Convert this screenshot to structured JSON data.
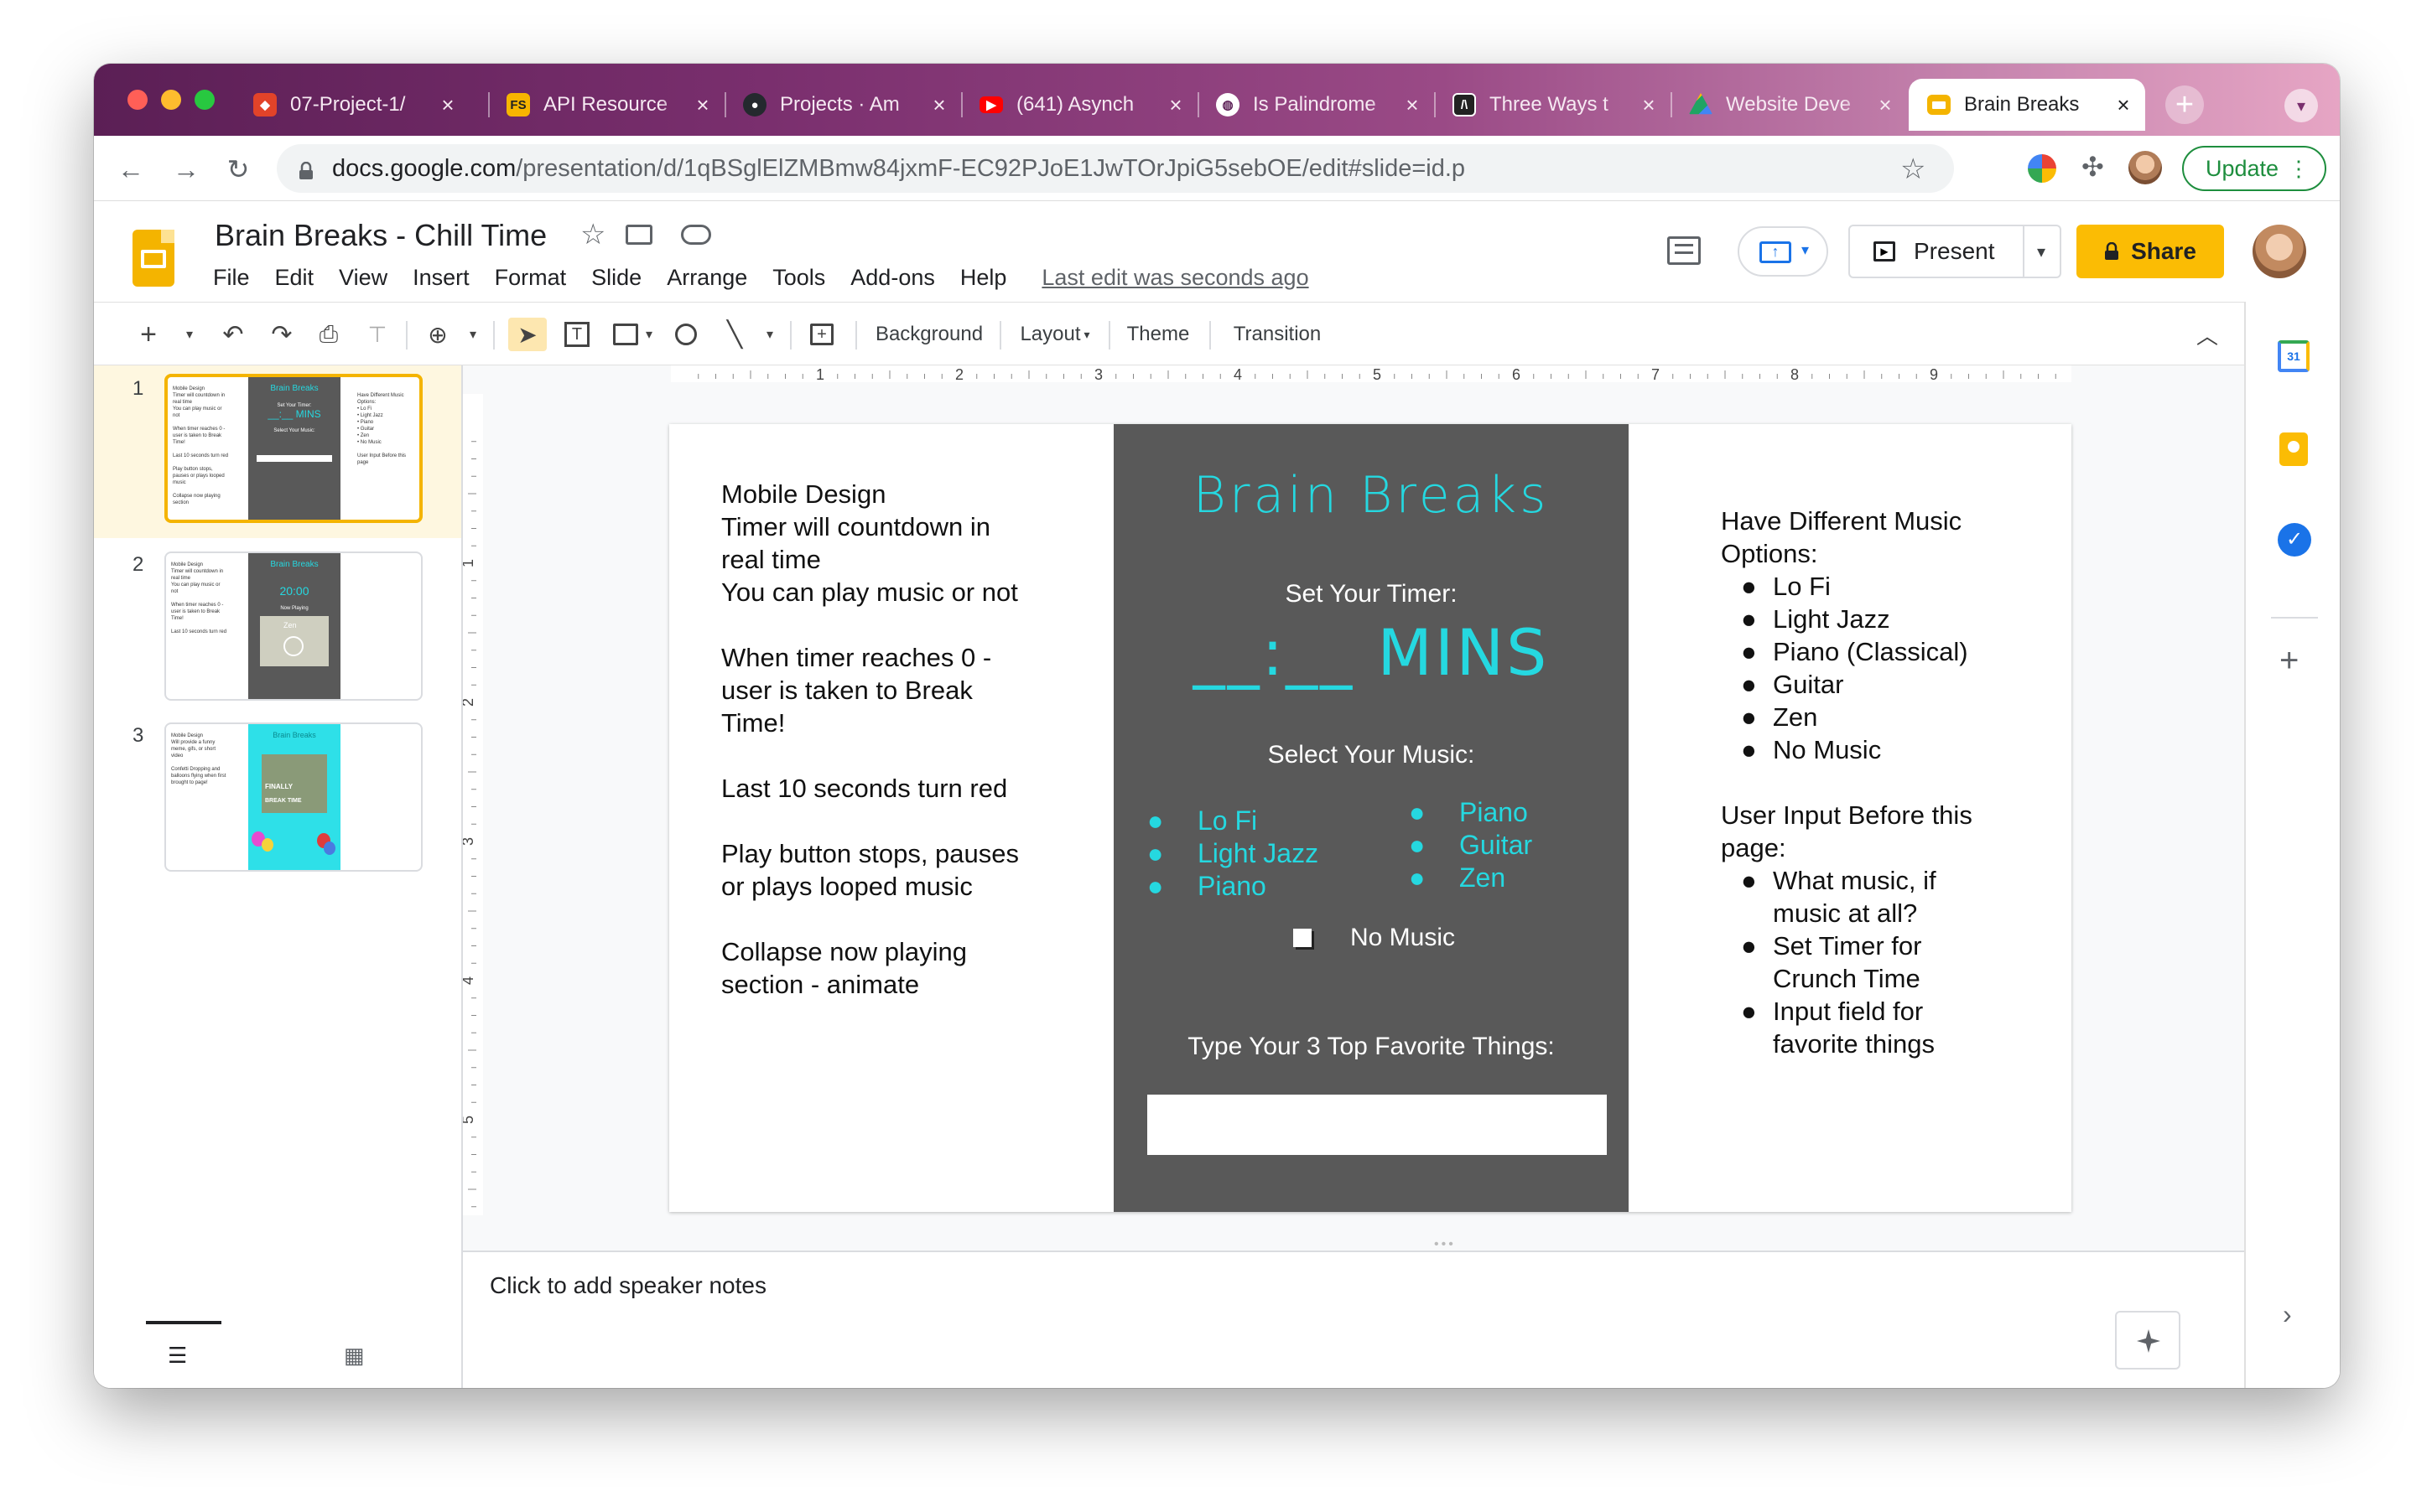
{
  "browser": {
    "tabs": [
      {
        "title": "07-Project-1/",
        "icon": "gitlab-icon",
        "color": "#e24329"
      },
      {
        "title": "API Resource",
        "icon": "fs-icon",
        "color": "#f7b500"
      },
      {
        "title": "Projects · Am",
        "icon": "github-icon",
        "color": "#24292e"
      },
      {
        "title": "(641) Asynch",
        "icon": "youtube-icon",
        "color": "#ff0000"
      },
      {
        "title": "Is Palindrome",
        "icon": "globe-icon",
        "color": "#ffffff"
      },
      {
        "title": "Three Ways t",
        "icon": "code-icon",
        "color": "#222222"
      },
      {
        "title": "Website Deve",
        "icon": "drive-icon",
        "color": "#1fa463"
      },
      {
        "title": "Brain Breaks",
        "icon": "slides-icon",
        "color": "#f4b400"
      }
    ],
    "url_host": "docs.google.com",
    "url_path": "/presentation/d/1qBSglElZMBmw84jxmF-EC92PJoE1JwTOrJpiG5sebOE/edit#slide=id.p",
    "update_label": "Update"
  },
  "doc": {
    "title": "Brain Breaks - Chill Time",
    "menu": [
      "File",
      "Edit",
      "View",
      "Insert",
      "Format",
      "Slide",
      "Arrange",
      "Tools",
      "Add-ons",
      "Help"
    ],
    "last_edit": "Last edit was seconds ago",
    "present_label": "Present",
    "share_label": "Share"
  },
  "toolbar": {
    "background_label": "Background",
    "layout_label": "Layout",
    "theme_label": "Theme",
    "transition_label": "Transition"
  },
  "ruler": [
    "1",
    "2",
    "3",
    "4",
    "5",
    "6",
    "7",
    "8",
    "9"
  ],
  "vruler": [
    "1",
    "2",
    "3",
    "4",
    "5"
  ],
  "thumbnails": [
    "1",
    "2",
    "3"
  ],
  "slide": {
    "left_lines": [
      "Mobile Design",
      "Timer will countdown in",
      "real time",
      "You can play music or not",
      "",
      "When timer reaches 0 -",
      "user is taken to Break",
      "Time!",
      "",
      "Last 10 seconds turn red",
      "",
      "Play button stops, pauses",
      "or plays looped music",
      "",
      "Collapse now playing",
      "section - animate"
    ],
    "phone_title": "Brain Breaks",
    "set_timer": "Set Your Timer:",
    "timer_value": "__:__ MINS",
    "select_music": "Select Your Music:",
    "music_left": [
      "Lo Fi",
      "Light Jazz",
      "Piano"
    ],
    "music_right": [
      "Piano",
      "Guitar",
      "Zen"
    ],
    "no_music": "No Music",
    "favorites_label": "Type Your 3 Top Favorite Things:",
    "right_heading": "Have Different Music Options:",
    "right_options": [
      "Lo Fi",
      "Light Jazz",
      "Piano (Classical)",
      "Guitar",
      "Zen",
      "No Music"
    ],
    "input_heading": "User Input Before this page:",
    "input_items": [
      "What music, if music at all?",
      "Set Timer for Crunch Time",
      "Input field for favorite things"
    ]
  },
  "thumb2": {
    "timer": "20:00",
    "now_playing": "Now Playing",
    "track": "Zen"
  },
  "thumb3": {
    "finally": "FINALLY",
    "break_time": "BREAK TIME"
  },
  "notes_placeholder": "Click to add speaker notes",
  "colors": {
    "accent_cyan": "#25d8e0",
    "phone_bg": "#595959",
    "share_yellow": "#fbbc04",
    "selected_border": "#f4b400"
  }
}
